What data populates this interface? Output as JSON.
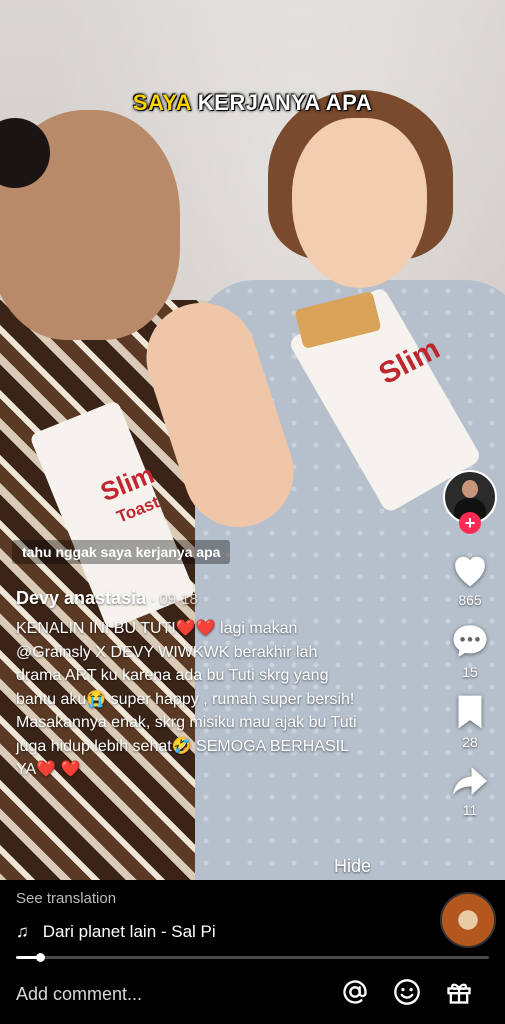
{
  "video": {
    "caption_highlight": "SAYA",
    "caption_rest": " KERJANYA APA",
    "subtitle": "tahu nggak saya kerjanya apa",
    "product_logo_1": "Slim",
    "product_logo_2": "Toast",
    "product_logo_3": "Slim"
  },
  "sidebar": {
    "follow_symbol": "+",
    "likes": "865",
    "comments": "15",
    "saves": "28",
    "shares": "11"
  },
  "post": {
    "author": "Devy anastasia",
    "date": " · 09-18",
    "description": "KENALIN INI BU TUTI❤️❤️ lagi makan @Grainsly X DEVY WIWKWK berakhir lah drama ART ku karena ada bu Tuti skrg yang bantu aku😭 super happy , rumah super bersih! Masakannya enak, skrg misiku mau ajak bu Tuti juga hidup lebih sehat🤣 SEMOGA BERHASIL YA❤️ ❤️",
    "hide_label": "Hide",
    "see_translation": "See translation"
  },
  "music": {
    "title": "Dari planet lain - Sal Pi",
    "note_icon": "♫"
  },
  "playback": {
    "progress": 0.05
  },
  "comment_bar": {
    "placeholder": "Add comment..."
  },
  "colors": {
    "follow_accent": "#fe2c55",
    "caption_highlight": "#ffd400"
  }
}
